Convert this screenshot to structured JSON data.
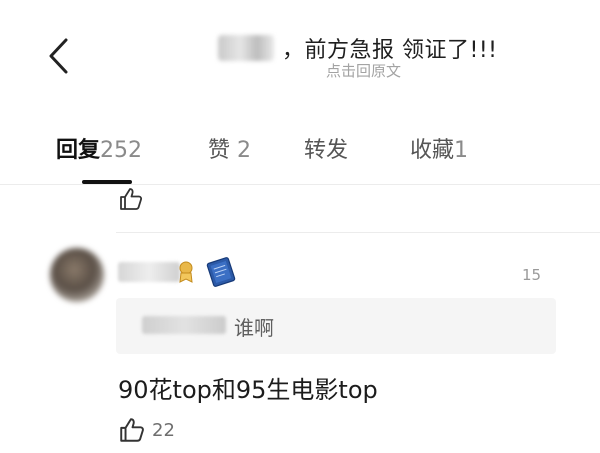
{
  "header": {
    "back_icon": "chevron-left-icon",
    "title": "，前方急报  领证了!!!",
    "subtitle": "点击回原文"
  },
  "tabs": [
    {
      "label": "回复",
      "count": "252",
      "active": true
    },
    {
      "label": "赞",
      "count": "2",
      "active": false
    },
    {
      "label": "转发",
      "count": "",
      "active": false
    },
    {
      "label": "收藏",
      "count": "1",
      "active": false
    }
  ],
  "comment": {
    "time": "15",
    "quote_text": "谁啊",
    "text": "90花top和95生电影top",
    "like_count": "22"
  },
  "colors": {
    "background": "#ffffff",
    "text": "#222222",
    "muted": "#9a9a9a",
    "quote_bg": "#f5f5f5"
  }
}
